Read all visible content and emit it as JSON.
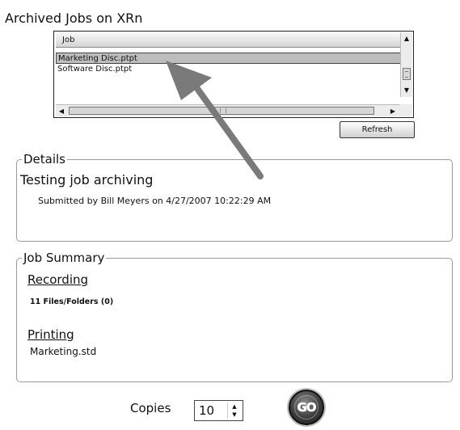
{
  "header": {
    "title": "Archived Jobs on XRn"
  },
  "job_list": {
    "column_header": "Job",
    "rows": [
      "Marketing Disc.ptpt",
      "Software Disc.ptpt"
    ],
    "selected_index": 0
  },
  "refresh_button": {
    "label": "Refresh"
  },
  "details": {
    "legend": "Details",
    "job_name": "Testing job archiving",
    "submitted": "Submitted by Bill Meyers on 4/27/2007 10:22:29 AM"
  },
  "job_summary": {
    "legend": "Job Summary",
    "recording_heading": "Recording",
    "recording_value": "11 Files/Folders (0)",
    "printing_heading": "Printing",
    "printing_value": "Marketing.std"
  },
  "footer": {
    "copies_label": "Copies",
    "copies_value": "10",
    "go_label": "GO"
  },
  "icons": {
    "scroll_up": "scroll-up-arrow",
    "scroll_down": "scroll-down-arrow",
    "scroll_left": "scroll-left-arrow",
    "scroll_right": "scroll-right-arrow",
    "annotation": "annotation-arrow"
  },
  "colors": {
    "selected_row": "#bdbdbd",
    "annotation_arrow": "#7a7a7a",
    "go_button": "#3d3d3d"
  }
}
